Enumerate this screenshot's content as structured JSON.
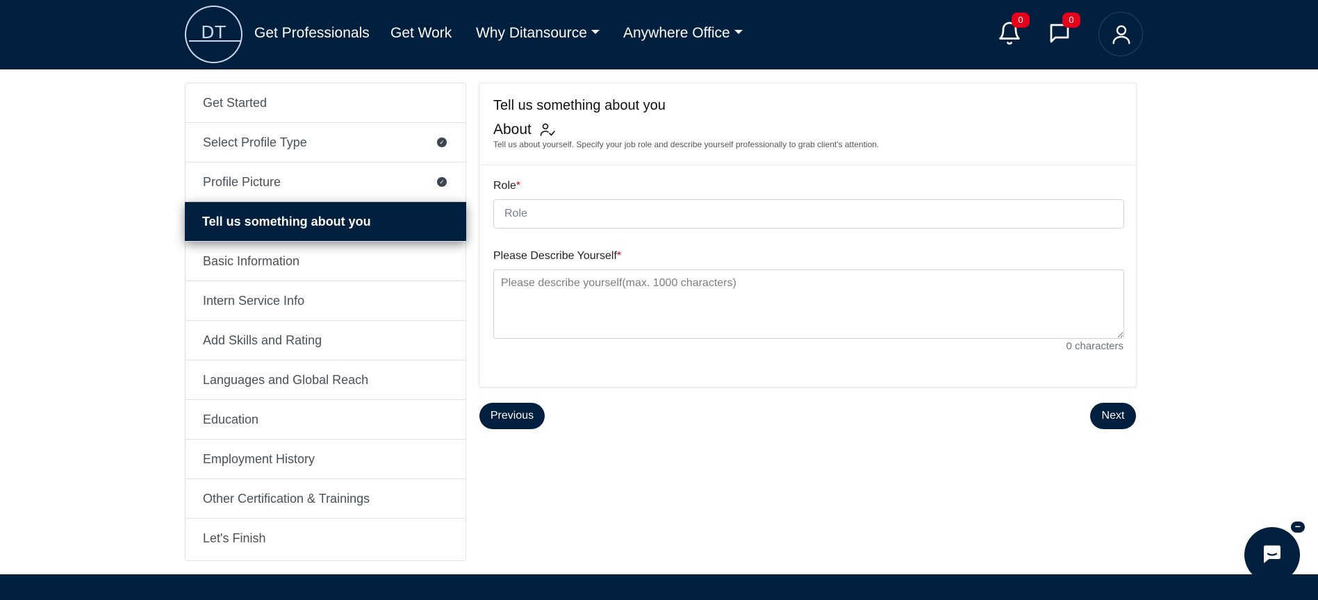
{
  "navbar": {
    "logo_text": "DT",
    "links": [
      "Get Professionals",
      "Get Work",
      "Why Ditansource",
      "Anywhere Office"
    ],
    "notifications_count": "0",
    "messages_count": "0",
    "icons": [
      "bell-icon",
      "chat-icon",
      "user-icon",
      "caret-down-icon"
    ]
  },
  "sidebar": {
    "items": [
      {
        "label": "Get Started",
        "state": "default"
      },
      {
        "label": "Select Profile Type",
        "state": "completed"
      },
      {
        "label": "Profile Picture",
        "state": "completed"
      },
      {
        "label": "Tell us something about you",
        "state": "active"
      },
      {
        "label": "Basic Information",
        "state": "default"
      },
      {
        "label": "Intern Service Info",
        "state": "default"
      },
      {
        "label": "Add Skills and Rating",
        "state": "default"
      },
      {
        "label": "Languages and Global Reach",
        "state": "default"
      },
      {
        "label": "Education",
        "state": "default"
      },
      {
        "label": "Employment History",
        "state": "default"
      },
      {
        "label": "Other Certification & Trainings",
        "state": "default"
      },
      {
        "label": "Let's Finish",
        "state": "default"
      }
    ]
  },
  "main": {
    "title": "Tell us something about you",
    "section_title": "About",
    "section_desc": "Tell us about yourself. Specify your job role and describe yourself professionally to grab client's attention.",
    "role": {
      "label": "Role",
      "required_mark": "*",
      "value": "",
      "placeholder": "Role"
    },
    "describe": {
      "label": "Please Describe Yourself",
      "required_mark": "*",
      "value": "",
      "placeholder": "Please describe yourself(max. 1000 characters)"
    },
    "char_count": "0 characters",
    "prev_label": "Previous",
    "next_label": "Next"
  },
  "chat": {
    "minimize_label": "−"
  },
  "colors": {
    "primary": "#011f3f",
    "badge": "#e3001b",
    "required": "#e3001b"
  }
}
